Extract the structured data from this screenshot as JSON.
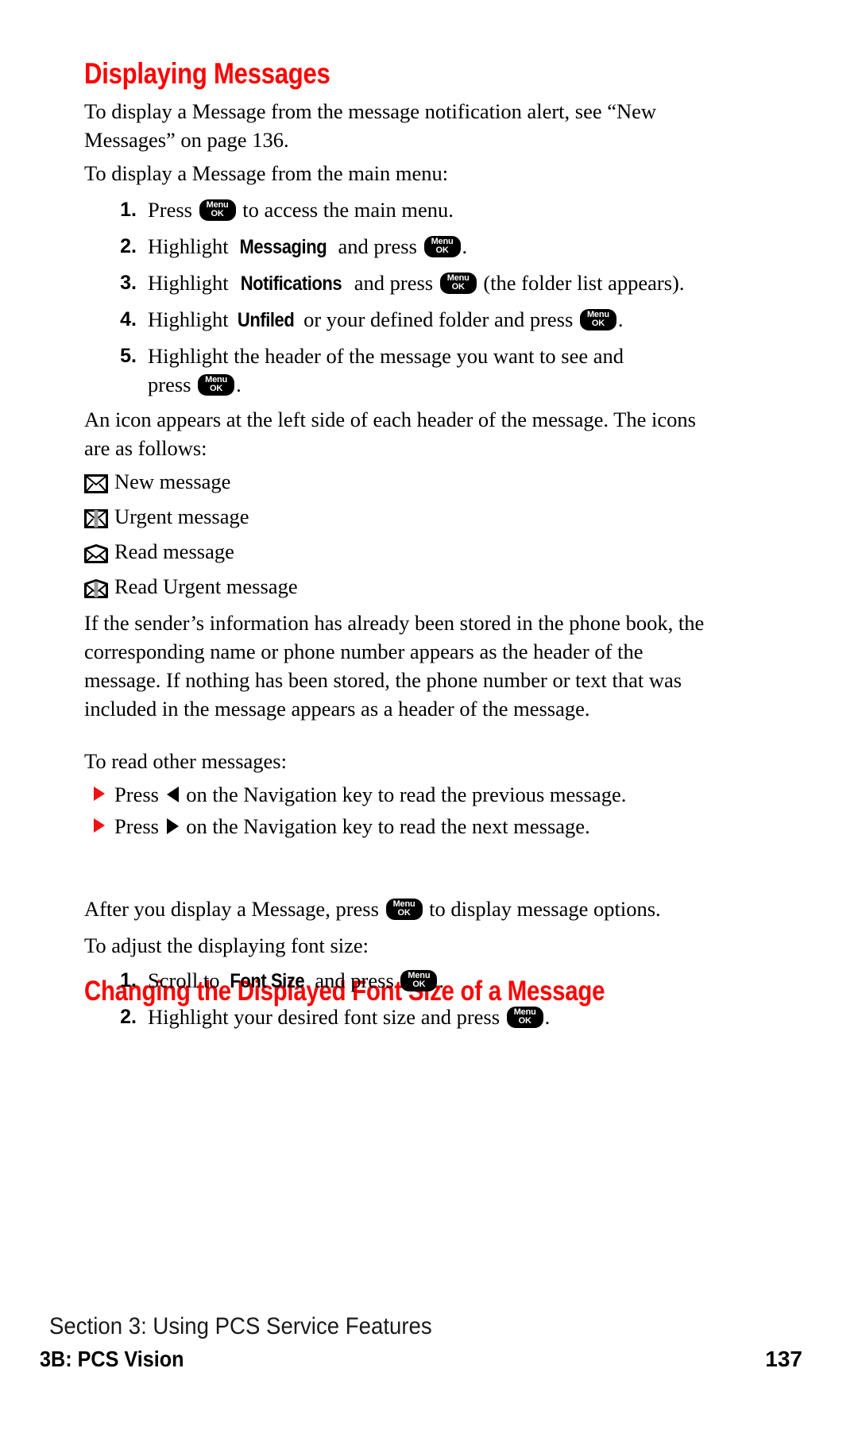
{
  "document": {
    "type": "phone-user-guide-page",
    "accent_color": "#ff0000",
    "text_color": "#000000",
    "background_color": "#ffffff"
  },
  "section1": {
    "heading": "Displaying Messages",
    "intro1": "To display a Message from the message notification alert, see “New Messages” on page 136.",
    "intro2": "To display a Message from the main menu:",
    "steps": [
      {
        "num": "1.",
        "pre": "Press ",
        "term": "",
        "post": " to access the main menu.",
        "key": "menu-ok"
      },
      {
        "num": "2.",
        "pre": "Highlight ",
        "term": "Messaging",
        "post": " and press ",
        "tail": ".",
        "key": "menu-ok"
      },
      {
        "num": "3.",
        "pre": "Highlight ",
        "term": "Notifications",
        "post": " and press ",
        "tail": " (the folder list appears).",
        "key": "menu-ok"
      },
      {
        "num": "4.",
        "pre": "Highlight ",
        "term": "Unfiled",
        "post": " or your defined folder and press ",
        "tail": ".",
        "key": "menu-ok"
      },
      {
        "num": "5.",
        "pre": "Highlight the header of the message you want to see and press ",
        "term": "",
        "post": "",
        "tail": ".",
        "key": "menu-ok"
      }
    ],
    "icons_intro": "An icon appears at the left side of each header of the message. The icons are as follows:",
    "icon_list": [
      {
        "icon": "envelope-closed-icon",
        "label": "New message"
      },
      {
        "icon": "envelope-closed-urgent-icon",
        "label": "Urgent message"
      },
      {
        "icon": "envelope-open-icon",
        "label": "Read message"
      },
      {
        "icon": "envelope-open-urgent-icon",
        "label": "Read Urgent message"
      }
    ],
    "sender_para": "If the sender’s information has already been stored in the phone book, the corresponding name or phone number appears as the header of the message. If nothing has been stored, the phone number or text that was included in the message appears as a header of the message.",
    "read_other_intro": "To read other messages:",
    "bullets": [
      {
        "pre": "Press ",
        "arrow": "left-arrow-icon",
        "post": " on the Navigation key to read the previous message."
      },
      {
        "pre": "Press ",
        "arrow": "right-arrow-icon",
        "post": " on the Navigation key to read the next message."
      }
    ]
  },
  "section2": {
    "heading": "Changing the Displayed Font Size of a Message",
    "intro1_pre": "After you display a Message, press ",
    "intro1_post": " to display message options.",
    "intro2": "To adjust the displaying font size:",
    "steps": [
      {
        "num": "1.",
        "pre": "Scroll to ",
        "term": "Font Size",
        "post": " and press ",
        "tail": ".",
        "key": "menu-ok"
      },
      {
        "num": "2.",
        "pre": "Highlight your desired font size and press ",
        "term": "",
        "post": "",
        "tail": ".",
        "key": "menu-ok"
      }
    ]
  },
  "key_glyph": {
    "line1": "Menu",
    "line2": "OK"
  },
  "footer": {
    "section": "Section 3: Using PCS Service Features",
    "book": "3B: PCS Vision",
    "page_number": "137"
  }
}
